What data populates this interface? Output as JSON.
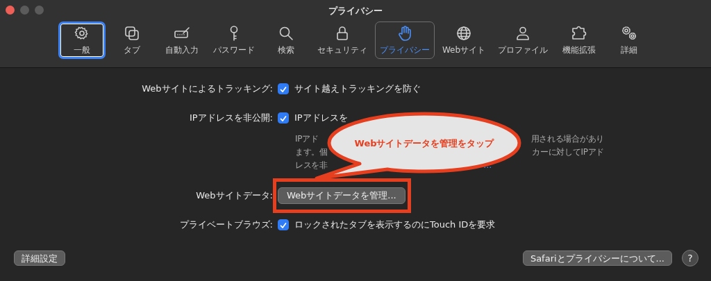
{
  "window": {
    "title": "プライバシー"
  },
  "toolbar": [
    {
      "label": "一般",
      "kind": "gear",
      "selected": false,
      "focused": true
    },
    {
      "label": "タブ",
      "kind": "tabs",
      "selected": false,
      "focused": false
    },
    {
      "label": "自動入力",
      "kind": "autofill",
      "selected": false,
      "focused": false
    },
    {
      "label": "パスワード",
      "kind": "key",
      "selected": false,
      "focused": false
    },
    {
      "label": "検索",
      "kind": "search",
      "selected": false,
      "focused": false
    },
    {
      "label": "セキュリティ",
      "kind": "lock",
      "selected": false,
      "focused": false
    },
    {
      "label": "プライバシー",
      "kind": "hand",
      "selected": true,
      "focused": false
    },
    {
      "label": "Webサイト",
      "kind": "globe",
      "selected": false,
      "focused": false
    },
    {
      "label": "プロファイル",
      "kind": "person",
      "selected": false,
      "focused": false
    },
    {
      "label": "機能拡張",
      "kind": "puzzle",
      "selected": false,
      "focused": false
    },
    {
      "label": "詳細",
      "kind": "gears",
      "selected": false,
      "focused": false
    }
  ],
  "settings": [
    {
      "kind": "checkbox",
      "label": "Webサイトによるトラッキング:",
      "option": "サイト越えトラッキングを防ぐ",
      "checked": true
    },
    {
      "kind": "checkbox",
      "label": "IPアドレスを非公開:",
      "option": "IPアドレスを",
      "checked": true,
      "description": [
        {
          "left": "IPアド",
          "right": "用される場合があり"
        },
        {
          "left": "ます。個",
          "right": "カーに対してIPアド"
        },
        {
          "left": "レスを非",
          "link": "…"
        }
      ]
    },
    {
      "kind": "button",
      "label": "Webサイトデータ:",
      "button": "Webサイトデータを管理...",
      "highlighted": true
    },
    {
      "kind": "checkbox",
      "label": "プライベートブラウズ:",
      "option": "ロックされたタブを表示するのにTouch IDを要求",
      "checked": true
    }
  ],
  "footer": {
    "left_button": "詳細設定",
    "right_button": "Safariとプライバシーについて...",
    "help": "?"
  },
  "annotation": {
    "callout": "Webサイトデータを管理をタップ"
  }
}
